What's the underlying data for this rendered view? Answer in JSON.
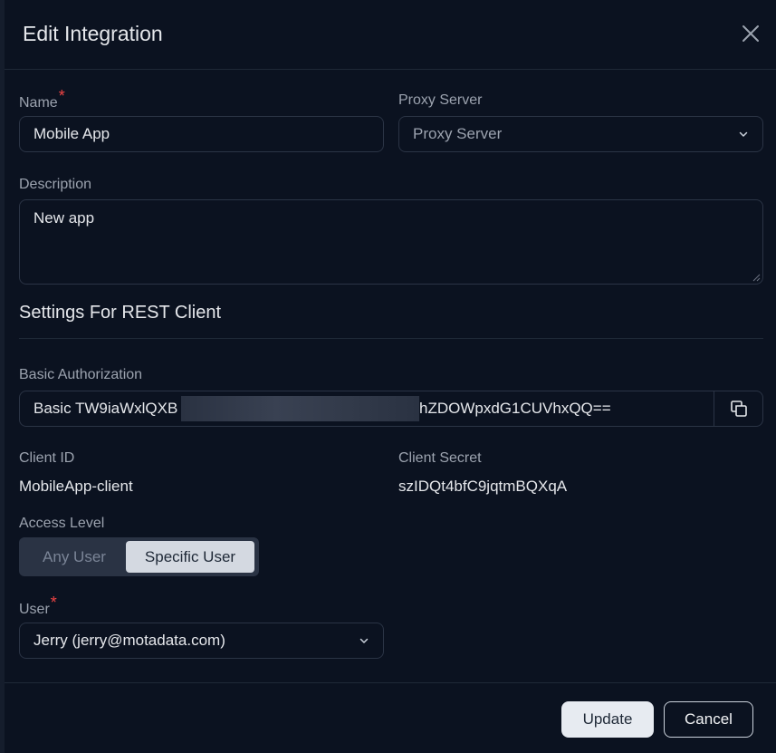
{
  "dialog": {
    "title": "Edit Integration"
  },
  "form": {
    "name": {
      "label": "Name",
      "required_mark": "*",
      "value": "Mobile App"
    },
    "proxy": {
      "label": "Proxy Server",
      "placeholder": "Proxy Server"
    },
    "description": {
      "label": "Description",
      "value": "New app"
    }
  },
  "rest_settings": {
    "section_title": "Settings For REST Client",
    "basic_auth": {
      "label": "Basic Authorization",
      "value_prefix": "Basic TW9iaWxlQXB",
      "value_suffix": "hZDOWpxdG1CUVhxQQ==",
      "copy_icon": "copy-icon"
    },
    "client_id": {
      "label": "Client ID",
      "value": "MobileApp-client"
    },
    "client_secret": {
      "label": "Client Secret",
      "value": "szIDQt4bfC9jqtmBQXqA"
    },
    "access_level": {
      "label": "Access Level",
      "options": [
        "Any User",
        "Specific User"
      ],
      "selected": "Specific User"
    },
    "user": {
      "label": "User",
      "required_mark": "*",
      "value": "Jerry (jerry@motadata.com)"
    }
  },
  "footer": {
    "update_label": "Update",
    "cancel_label": "Cancel"
  },
  "colors": {
    "background": "#0b1220",
    "border": "#2b3445",
    "required": "#ef4444",
    "muted_text": "#9ca3af"
  }
}
